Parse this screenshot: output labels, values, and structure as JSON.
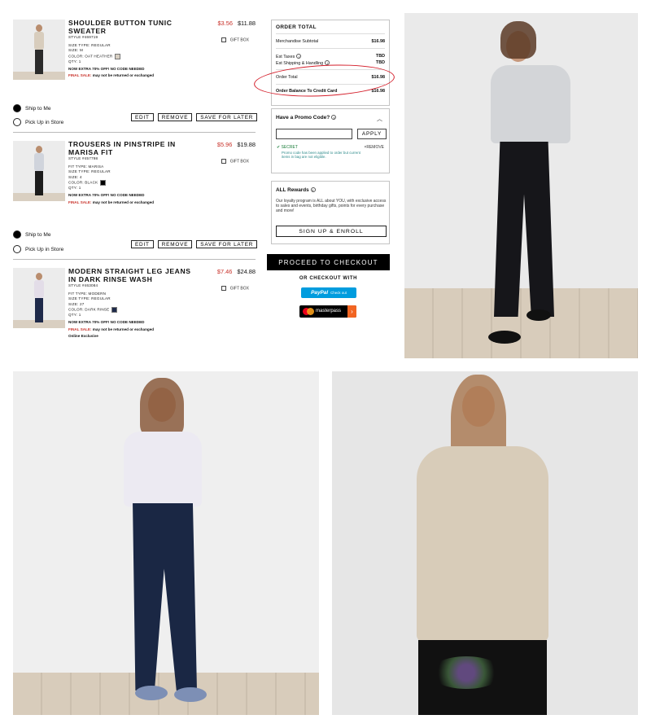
{
  "cart": {
    "items": [
      {
        "title": "SHOULDER BUTTON TUNIC SWEATER",
        "style": "STYLE #469719",
        "specs": [
          "SIZE TYPE: REGULAR",
          "SIZE: M",
          "COLOR: OAT HEATHER",
          "QTY: 1"
        ],
        "promo": "NOW EXTRA 70% OFF! NO CODE NEEDED",
        "final_sale": "FINAL SALE:",
        "final_text": "may not be returned or exchanged",
        "extra": "",
        "sale_price": "$3.56",
        "price": "$11.88",
        "gift": "GIFT BOX",
        "swatch_color": "#d7cfc2"
      },
      {
        "title": "TROUSERS IN PINSTRIPE IN MARISA FIT",
        "style": "STYLE #457798",
        "specs": [
          "FIT TYPE: MARISA",
          "SIZE TYPE: REGULAR",
          "SIZE: 4",
          "COLOR: BLACK",
          "QTY: 1"
        ],
        "promo": "NOW EXTRA 70% OFF! NO CODE NEEDED",
        "final_sale": "FINAL SALE:",
        "final_text": "may not be returned or exchanged",
        "extra": "",
        "sale_price": "$5.96",
        "price": "$19.88",
        "gift": "GIFT BOX",
        "swatch_color": "#000000"
      },
      {
        "title": "MODERN STRAIGHT LEG JEANS IN DARK RINSE WASH",
        "style": "STYLE #463084",
        "specs": [
          "FIT TYPE: MODERN",
          "SIZE TYPE: REGULAR",
          "SIZE: 27",
          "COLOR: DARK RINSE",
          "QTY: 1"
        ],
        "promo": "NOW EXTRA 70% OFF! NO CODE NEEDED",
        "final_sale": "FINAL SALE:",
        "final_text": "may not be returned or exchanged",
        "extra": "Online Exclusive",
        "sale_price": "$7.46",
        "price": "$24.88",
        "gift": "GIFT BOX",
        "swatch_color": "#1e2a4a"
      }
    ],
    "ship_to_me": "Ship to Me",
    "pick_up": "Pick Up in Store",
    "edit": "EDIT",
    "remove": "REMOVE",
    "save_later": "SAVE FOR LATER"
  },
  "order_total": {
    "title": "ORDER TOTAL",
    "subtotal_label": "Merchandise Subtotal",
    "subtotal": "$16.98",
    "taxes_label": "Est Taxes",
    "taxes": "TBD",
    "shipping_label": "Est Shipping & Handling",
    "shipping": "TBD",
    "total_label": "Order Total",
    "total": "$16.98",
    "balance_label": "Order Balance To Credit Card",
    "balance": "$16.98"
  },
  "promo": {
    "title": "Have a Promo Code?",
    "input_value": "",
    "apply": "APPLY",
    "code": "SECRET",
    "remove": "REMOVE",
    "message": "Promo code has been applied to order but current items in bag are not eligible."
  },
  "rewards": {
    "title": "ALL Rewards",
    "text": "Our loyalty program is ALL about YOU, with exclusive access to sales and events, birthday gifts, points for every purchase and more!",
    "signup": "SIGN UP & ENROLL"
  },
  "checkout": {
    "proceed": "PROCEED TO CHECKOUT",
    "or_label": "OR CHECKOUT WITH",
    "paypal": "PayPal",
    "paypal_sub": "Check out",
    "masterpass": "masterpass"
  },
  "colors": {
    "sale_red": "#c8322a",
    "annotation_red": "#d41e2a",
    "paypal_blue": "#009cde",
    "promo_green": "#1a7d3a"
  }
}
